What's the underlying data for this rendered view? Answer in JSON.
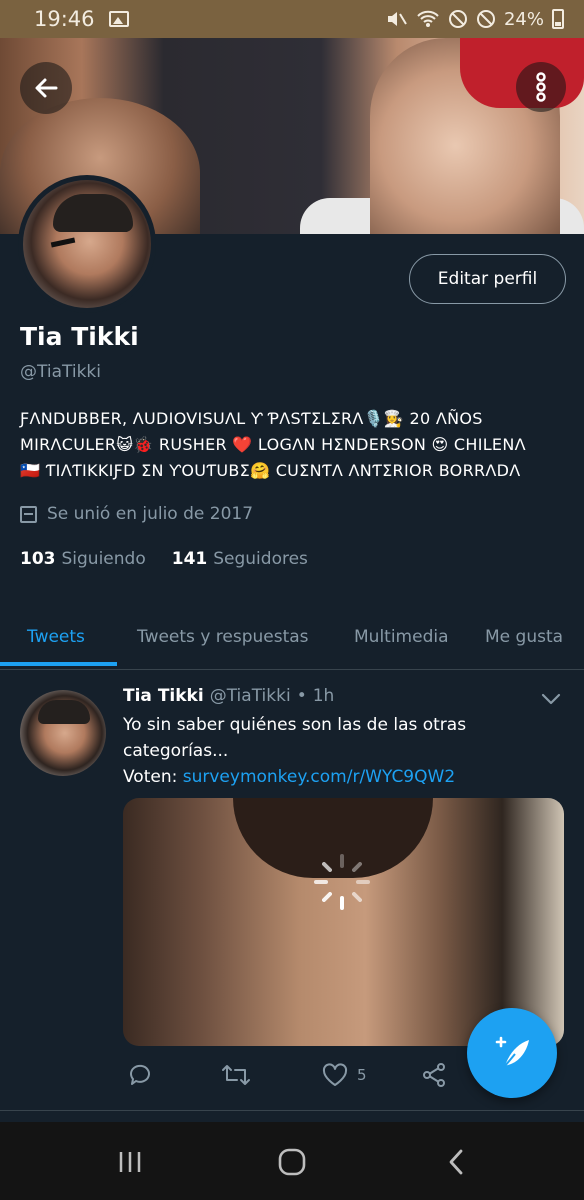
{
  "status_bar": {
    "time": "19:46",
    "battery": "24%",
    "background": "#7a6240"
  },
  "colors": {
    "background": "#15202b",
    "accent": "#1da1f2",
    "secondary_text": "#8899a6",
    "border": "#38444d"
  },
  "header": {
    "back_icon": "arrow-left-icon",
    "more_icon": "more-vertical-icon"
  },
  "profile": {
    "edit_button": "Editar perfil",
    "name": "Tia Tikki",
    "handle": "@TiaTikki",
    "bio_line1": "ƑΛNDUBBER, ΛUDIOVISUΛL Ƴ ƤΛSƬΣLΣRΛ🎙️👩‍🍳 20 ΛÑOS",
    "bio_line2": "MIRΛCULER😺🐞 RUSHER ❤️ LOGΛN HΣNDERSON 😍 CHILENΛ",
    "bio_line3": "🇨🇱 ƬIΛƬIKKIƑD ΣN ƳOUƬUBΣ🤗 CUΣNƬΛ ΛNƬΣRIOR BORRΛDΛ",
    "joined": "Se unió en julio de 2017",
    "following_count": "103",
    "following_label": "Siguiendo",
    "followers_count": "141",
    "followers_label": "Seguidores"
  },
  "tabs": [
    {
      "label": "Tweets",
      "active": true
    },
    {
      "label": "Tweets y respuestas",
      "active": false
    },
    {
      "label": "Multimedia",
      "active": false
    },
    {
      "label": "Me gusta",
      "active": false
    }
  ],
  "tweet": {
    "name": "Tia Tikki",
    "handle": "@TiaTikki",
    "separator": "•",
    "time": "1h",
    "text": "Yo sin saber quiénes son las de las otras categorías...",
    "link_prefix": "Voten:",
    "link": "surveymonkey.com/r/WYC9QW2",
    "like_count": "5",
    "icons": [
      "reply-icon",
      "retweet-icon",
      "like-icon",
      "share-icon"
    ]
  },
  "fab": {
    "icon": "compose-tweet-icon"
  },
  "nav_bar": {
    "icons": [
      "recent-apps-icon",
      "home-icon",
      "back-icon"
    ]
  }
}
